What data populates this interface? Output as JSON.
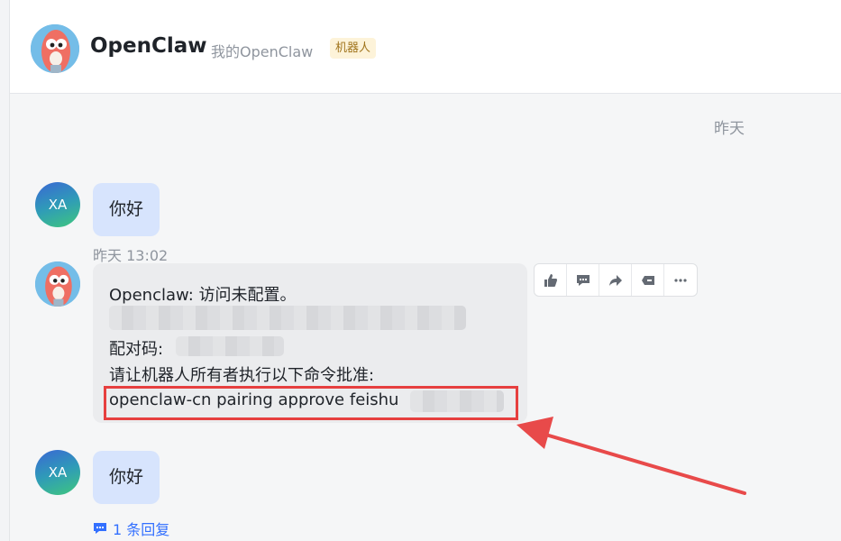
{
  "header": {
    "title": "OpenClaw",
    "subtitle": "我的OpenClaw",
    "badge": "机器人"
  },
  "date_separator": "昨天",
  "messages": [
    {
      "sender_initials": "XA",
      "text": "你好"
    },
    {
      "timestamp": "昨天 13:02",
      "lines": {
        "line1": "Openclaw: 访问未配置。",
        "line3": "配对码:",
        "line4": "请让机器人所有者执行以下命令批准:",
        "line5": "openclaw-cn pairing approve feishu"
      }
    },
    {
      "sender_initials": "XA",
      "text": "你好",
      "reply_label": "1 条回复"
    }
  ],
  "toolbar_icons": [
    "thumbs-up-icon",
    "comment-icon",
    "forward-icon",
    "mark-icon",
    "more-icon"
  ],
  "colors": {
    "accent": "#3370ff",
    "highlight": "#e63f3f",
    "user_bubble": "#d7e4fd",
    "bot_bubble": "#ebecee"
  }
}
